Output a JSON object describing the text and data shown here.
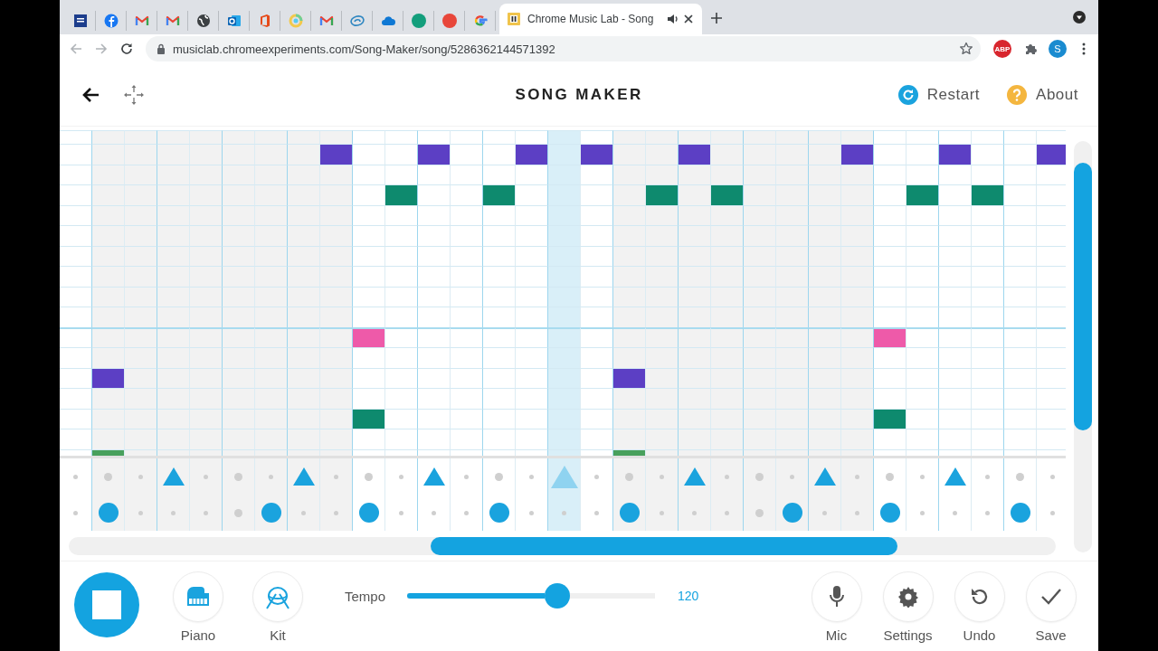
{
  "browser": {
    "tabs": [
      {
        "kind": "news",
        "selected": false
      },
      {
        "kind": "facebook",
        "selected": false
      },
      {
        "kind": "mail",
        "selected": false
      },
      {
        "kind": "mail",
        "selected": false
      },
      {
        "kind": "globe",
        "selected": false
      },
      {
        "kind": "outlook",
        "selected": false
      },
      {
        "kind": "office",
        "selected": false
      },
      {
        "kind": "ring",
        "selected": false
      },
      {
        "kind": "mail",
        "selected": false
      },
      {
        "kind": "swirl",
        "selected": false
      },
      {
        "kind": "cloud",
        "selected": false
      },
      {
        "kind": "dot",
        "color": "#139e7c",
        "selected": false
      },
      {
        "kind": "dot",
        "color": "#e8463a",
        "selected": false
      },
      {
        "kind": "google",
        "selected": false
      },
      {
        "kind": "page",
        "title": "Chrome Music Lab - Song",
        "audio": true,
        "selected": true
      }
    ],
    "address": "musiclab.chromeexperiments.com/Song-Maker/song/5286362144571392",
    "adblock_label": "ABP",
    "profile_initial": "S"
  },
  "app": {
    "title": "SONG MAKER",
    "header_actions": [
      {
        "kind": "restart",
        "label": "Restart"
      },
      {
        "kind": "about",
        "label": "About"
      }
    ],
    "grid": {
      "steps": [
        {
          "current": false,
          "triangle": false,
          "circle": false
        },
        {
          "current": false,
          "triangle": false,
          "circle": true
        },
        {
          "current": false,
          "triangle": false,
          "circle": false
        },
        {
          "current": false,
          "triangle": true,
          "circle": false
        },
        {
          "current": false,
          "triangle": false,
          "circle": false
        },
        {
          "current": false,
          "triangle": false,
          "circle": false
        },
        {
          "current": false,
          "triangle": false,
          "circle": true
        },
        {
          "current": false,
          "triangle": true,
          "circle": false
        },
        {
          "current": false,
          "triangle": false,
          "circle": false
        },
        {
          "current": false,
          "triangle": false,
          "circle": true
        },
        {
          "current": false,
          "triangle": false,
          "circle": false
        },
        {
          "current": false,
          "triangle": true,
          "circle": false
        },
        {
          "current": false,
          "triangle": false,
          "circle": false
        },
        {
          "current": false,
          "triangle": false,
          "circle": true
        },
        {
          "current": false,
          "triangle": false,
          "circle": false
        },
        {
          "current": true,
          "triangle": true,
          "circle": false
        },
        {
          "current": false,
          "triangle": false,
          "circle": false
        },
        {
          "current": false,
          "triangle": false,
          "circle": true
        },
        {
          "current": false,
          "triangle": false,
          "circle": false
        },
        {
          "current": false,
          "triangle": true,
          "circle": false
        },
        {
          "current": false,
          "triangle": false,
          "circle": false
        },
        {
          "current": false,
          "triangle": false,
          "circle": false
        },
        {
          "current": false,
          "triangle": false,
          "circle": true
        },
        {
          "current": false,
          "triangle": true,
          "circle": false
        },
        {
          "current": false,
          "triangle": false,
          "circle": false
        },
        {
          "current": false,
          "triangle": false,
          "circle": true
        },
        {
          "current": false,
          "triangle": false,
          "circle": false
        },
        {
          "current": false,
          "triangle": true,
          "circle": false
        },
        {
          "current": false,
          "triangle": false,
          "circle": false
        },
        {
          "current": false,
          "triangle": false,
          "circle": true
        },
        {
          "current": false,
          "triangle": false,
          "circle": false
        }
      ],
      "melody_rows": [
        {
          "cells": [
            false,
            false,
            false,
            false,
            false,
            false,
            false,
            false,
            false,
            false,
            false,
            false,
            false,
            false,
            false,
            false,
            false,
            false,
            false,
            false,
            false,
            false,
            false,
            false,
            false,
            false,
            false,
            false,
            false,
            false,
            false
          ]
        },
        {
          "color": "#5c3fc4",
          "cells": [
            false,
            false,
            false,
            false,
            false,
            false,
            false,
            false,
            true,
            false,
            false,
            true,
            false,
            false,
            true,
            false,
            true,
            false,
            false,
            true,
            false,
            false,
            false,
            false,
            true,
            false,
            false,
            true,
            false,
            false,
            true
          ]
        },
        {
          "cells": [
            false,
            false,
            false,
            false,
            false,
            false,
            false,
            false,
            false,
            false,
            false,
            false,
            false,
            false,
            false,
            false,
            false,
            false,
            false,
            false,
            false,
            false,
            false,
            false,
            false,
            false,
            false,
            false,
            false,
            false,
            false
          ]
        },
        {
          "color": "#0e8a6e",
          "cells": [
            false,
            false,
            false,
            false,
            false,
            false,
            false,
            false,
            false,
            false,
            true,
            false,
            false,
            true,
            false,
            false,
            false,
            false,
            true,
            false,
            true,
            false,
            false,
            false,
            false,
            false,
            true,
            false,
            true,
            false,
            false
          ]
        },
        {
          "cells": [
            false,
            false,
            false,
            false,
            false,
            false,
            false,
            false,
            false,
            false,
            false,
            false,
            false,
            false,
            false,
            false,
            false,
            false,
            false,
            false,
            false,
            false,
            false,
            false,
            false,
            false,
            false,
            false,
            false,
            false,
            false
          ]
        },
        {
          "cells": [
            false,
            false,
            false,
            false,
            false,
            false,
            false,
            false,
            false,
            false,
            false,
            false,
            false,
            false,
            false,
            false,
            false,
            false,
            false,
            false,
            false,
            false,
            false,
            false,
            false,
            false,
            false,
            false,
            false,
            false,
            false
          ]
        },
        {
          "cells": [
            false,
            false,
            false,
            false,
            false,
            false,
            false,
            false,
            false,
            false,
            false,
            false,
            false,
            false,
            false,
            false,
            false,
            false,
            false,
            false,
            false,
            false,
            false,
            false,
            false,
            false,
            false,
            false,
            false,
            false,
            false
          ]
        },
        {
          "cells": [
            false,
            false,
            false,
            false,
            false,
            false,
            false,
            false,
            false,
            false,
            false,
            false,
            false,
            false,
            false,
            false,
            false,
            false,
            false,
            false,
            false,
            false,
            false,
            false,
            false,
            false,
            false,
            false,
            false,
            false,
            false
          ]
        },
        {
          "cells": [
            false,
            false,
            false,
            false,
            false,
            false,
            false,
            false,
            false,
            false,
            false,
            false,
            false,
            false,
            false,
            false,
            false,
            false,
            false,
            false,
            false,
            false,
            false,
            false,
            false,
            false,
            false,
            false,
            false,
            false,
            false
          ]
        },
        {
          "cells": [
            false,
            false,
            false,
            false,
            false,
            false,
            false,
            false,
            false,
            false,
            false,
            false,
            false,
            false,
            false,
            false,
            false,
            false,
            false,
            false,
            false,
            false,
            false,
            false,
            false,
            false,
            false,
            false,
            false,
            false,
            false
          ]
        },
        {
          "color": "#ee5aa9",
          "cells": [
            false,
            false,
            false,
            false,
            false,
            false,
            false,
            false,
            false,
            true,
            false,
            false,
            false,
            false,
            false,
            false,
            false,
            false,
            false,
            false,
            false,
            false,
            false,
            false,
            false,
            true,
            false,
            false,
            false,
            false,
            false
          ]
        },
        {
          "cells": [
            false,
            false,
            false,
            false,
            false,
            false,
            false,
            false,
            false,
            false,
            false,
            false,
            false,
            false,
            false,
            false,
            false,
            false,
            false,
            false,
            false,
            false,
            false,
            false,
            false,
            false,
            false,
            false,
            false,
            false,
            false
          ]
        },
        {
          "color": "#5c3fc4",
          "cells": [
            false,
            true,
            false,
            false,
            false,
            false,
            false,
            false,
            false,
            false,
            false,
            false,
            false,
            false,
            false,
            false,
            false,
            true,
            false,
            false,
            false,
            false,
            false,
            false,
            false,
            false,
            false,
            false,
            false,
            false,
            false
          ]
        },
        {
          "cells": [
            false,
            false,
            false,
            false,
            false,
            false,
            false,
            false,
            false,
            false,
            false,
            false,
            false,
            false,
            false,
            false,
            false,
            false,
            false,
            false,
            false,
            false,
            false,
            false,
            false,
            false,
            false,
            false,
            false,
            false,
            false
          ]
        },
        {
          "color": "#0e8a6e",
          "cells": [
            false,
            false,
            false,
            false,
            false,
            false,
            false,
            false,
            false,
            true,
            false,
            false,
            false,
            false,
            false,
            false,
            false,
            false,
            false,
            false,
            false,
            false,
            false,
            false,
            false,
            true,
            false,
            false,
            false,
            false,
            false
          ]
        },
        {
          "cells": [
            false,
            false,
            false,
            false,
            false,
            false,
            false,
            false,
            false,
            false,
            false,
            false,
            false,
            false,
            false,
            false,
            false,
            false,
            false,
            false,
            false,
            false,
            false,
            false,
            false,
            false,
            false,
            false,
            false,
            false,
            false
          ]
        },
        {
          "color": "#48a05c",
          "cells": [
            false,
            true,
            false,
            false,
            false,
            false,
            false,
            false,
            false,
            false,
            false,
            false,
            false,
            false,
            false,
            false,
            false,
            true,
            false,
            false,
            false,
            false,
            false,
            false,
            false,
            false,
            false,
            false,
            false,
            false,
            false
          ]
        }
      ]
    },
    "controls": {
      "playing": true,
      "instruments": [
        {
          "kind": "piano",
          "label": "Piano"
        },
        {
          "kind": "kit",
          "label": "Kit"
        }
      ],
      "tempo": {
        "label": "Tempo",
        "level": 0.606,
        "value": "120"
      },
      "tools": [
        {
          "kind": "mic",
          "label": "Mic"
        },
        {
          "kind": "settings",
          "label": "Settings"
        },
        {
          "kind": "undo",
          "label": "Undo"
        },
        {
          "kind": "save",
          "label": "Save"
        }
      ]
    }
  }
}
